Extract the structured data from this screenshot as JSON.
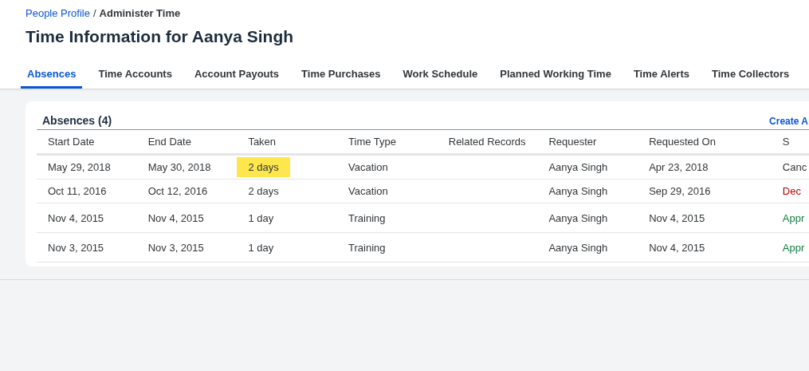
{
  "breadcrumb": {
    "link": "People Profile",
    "separator": "/",
    "current": "Administer Time"
  },
  "page_title": "Time Information for Aanya Singh",
  "tabs": [
    {
      "label": "Absences",
      "selected": true
    },
    {
      "label": "Time Accounts",
      "selected": false
    },
    {
      "label": "Account Payouts",
      "selected": false
    },
    {
      "label": "Time Purchases",
      "selected": false
    },
    {
      "label": "Work Schedule",
      "selected": false
    },
    {
      "label": "Planned Working Time",
      "selected": false
    },
    {
      "label": "Time Alerts",
      "selected": false
    },
    {
      "label": "Time Collectors",
      "selected": false
    }
  ],
  "absences": {
    "title": "Absences (4)",
    "create_link": "Create A",
    "columns": [
      "Start Date",
      "End Date",
      "Taken",
      "Time Type",
      "Related Records",
      "Requester",
      "Requested On",
      "S"
    ],
    "rows": [
      {
        "start_date": "May 29, 2018",
        "end_date": "May 30, 2018",
        "taken": "2 days",
        "taken_highlighted": true,
        "time_type": "Vacation",
        "requester": "Aanya Singh",
        "requested_on": "Apr 23, 2018",
        "status": "Canc",
        "color": "#32363a"
      },
      {
        "start_date": "Oct 11, 2016",
        "end_date": "Oct 12, 2016",
        "taken": "2 days",
        "taken_highlighted": false,
        "time_type": "Vacation",
        "requester": "Aanya Singh",
        "requested_on": "Sep 29, 2016",
        "status": "Dec",
        "color": "#bb0000"
      },
      {
        "start_date": "Nov 4, 2015",
        "end_date": "Nov 4, 2015",
        "taken": "1 day",
        "taken_highlighted": false,
        "time_type": "Training",
        "requester": "Aanya Singh",
        "requested_on": "Nov 4, 2015",
        "status": "Appr",
        "color": "#107e3e"
      },
      {
        "start_date": "Nov 3, 2015",
        "end_date": "Nov 3, 2015",
        "taken": "1 day",
        "taken_highlighted": false,
        "time_type": "Training",
        "requester": "Aanya Singh",
        "requested_on": "Nov 4, 2015",
        "status": "Appr",
        "color": "#107e3e"
      }
    ]
  }
}
